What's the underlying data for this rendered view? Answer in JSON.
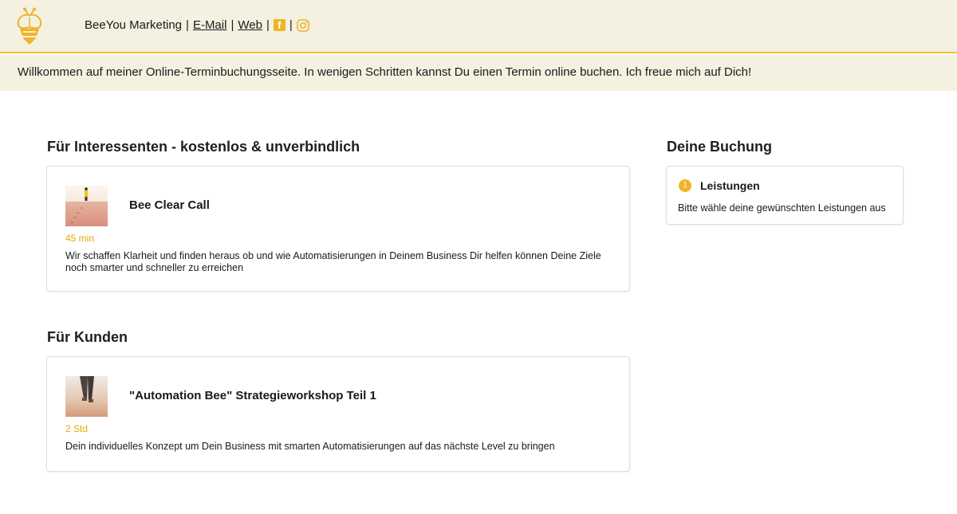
{
  "header": {
    "brand": "BeeYou Marketing",
    "sep1": "|",
    "email_link": "E-Mail",
    "sep2": "|",
    "web_link": "Web",
    "sep3": "|",
    "sep4": "|",
    "facebook_icon": "facebook-icon",
    "instagram_icon": "instagram-icon",
    "logo_icon": "bee-logo"
  },
  "welcome": {
    "text": "Willkommen auf meiner Online-Terminbuchungsseite. In wenigen Schritten kannst Du einen Termin online buchen. Ich freue mich auf Dich!"
  },
  "sections": [
    {
      "title": "Für Interessenten - kostenlos & unverbindlich",
      "services": [
        {
          "name": "Bee Clear Call",
          "duration": "45 min",
          "description": "Wir schaffen Klarheit und finden heraus ob und wie Automatisierungen in Deinem Business Dir helfen können Deine Ziele noch smarter und schneller zu erreichen"
        }
      ]
    },
    {
      "title": "Für Kunden",
      "services": [
        {
          "name": "\"Automation Bee\" Strategieworkshop Teil 1",
          "duration": "2 Std",
          "description": "Dein individuelles Konzept um Dein Business mit smarten Automatisierungen auf das nächste Level zu bringen"
        }
      ]
    }
  ],
  "booking": {
    "title": "Deine Buchung",
    "step_number": "1",
    "step_label": "Leistungen",
    "step_hint": "Bitte wähle deine gewünschten Leistungen aus"
  },
  "colors": {
    "accent": "#f0b429",
    "header_bg": "#f4f1e1",
    "duration_text": "#e6a800"
  }
}
